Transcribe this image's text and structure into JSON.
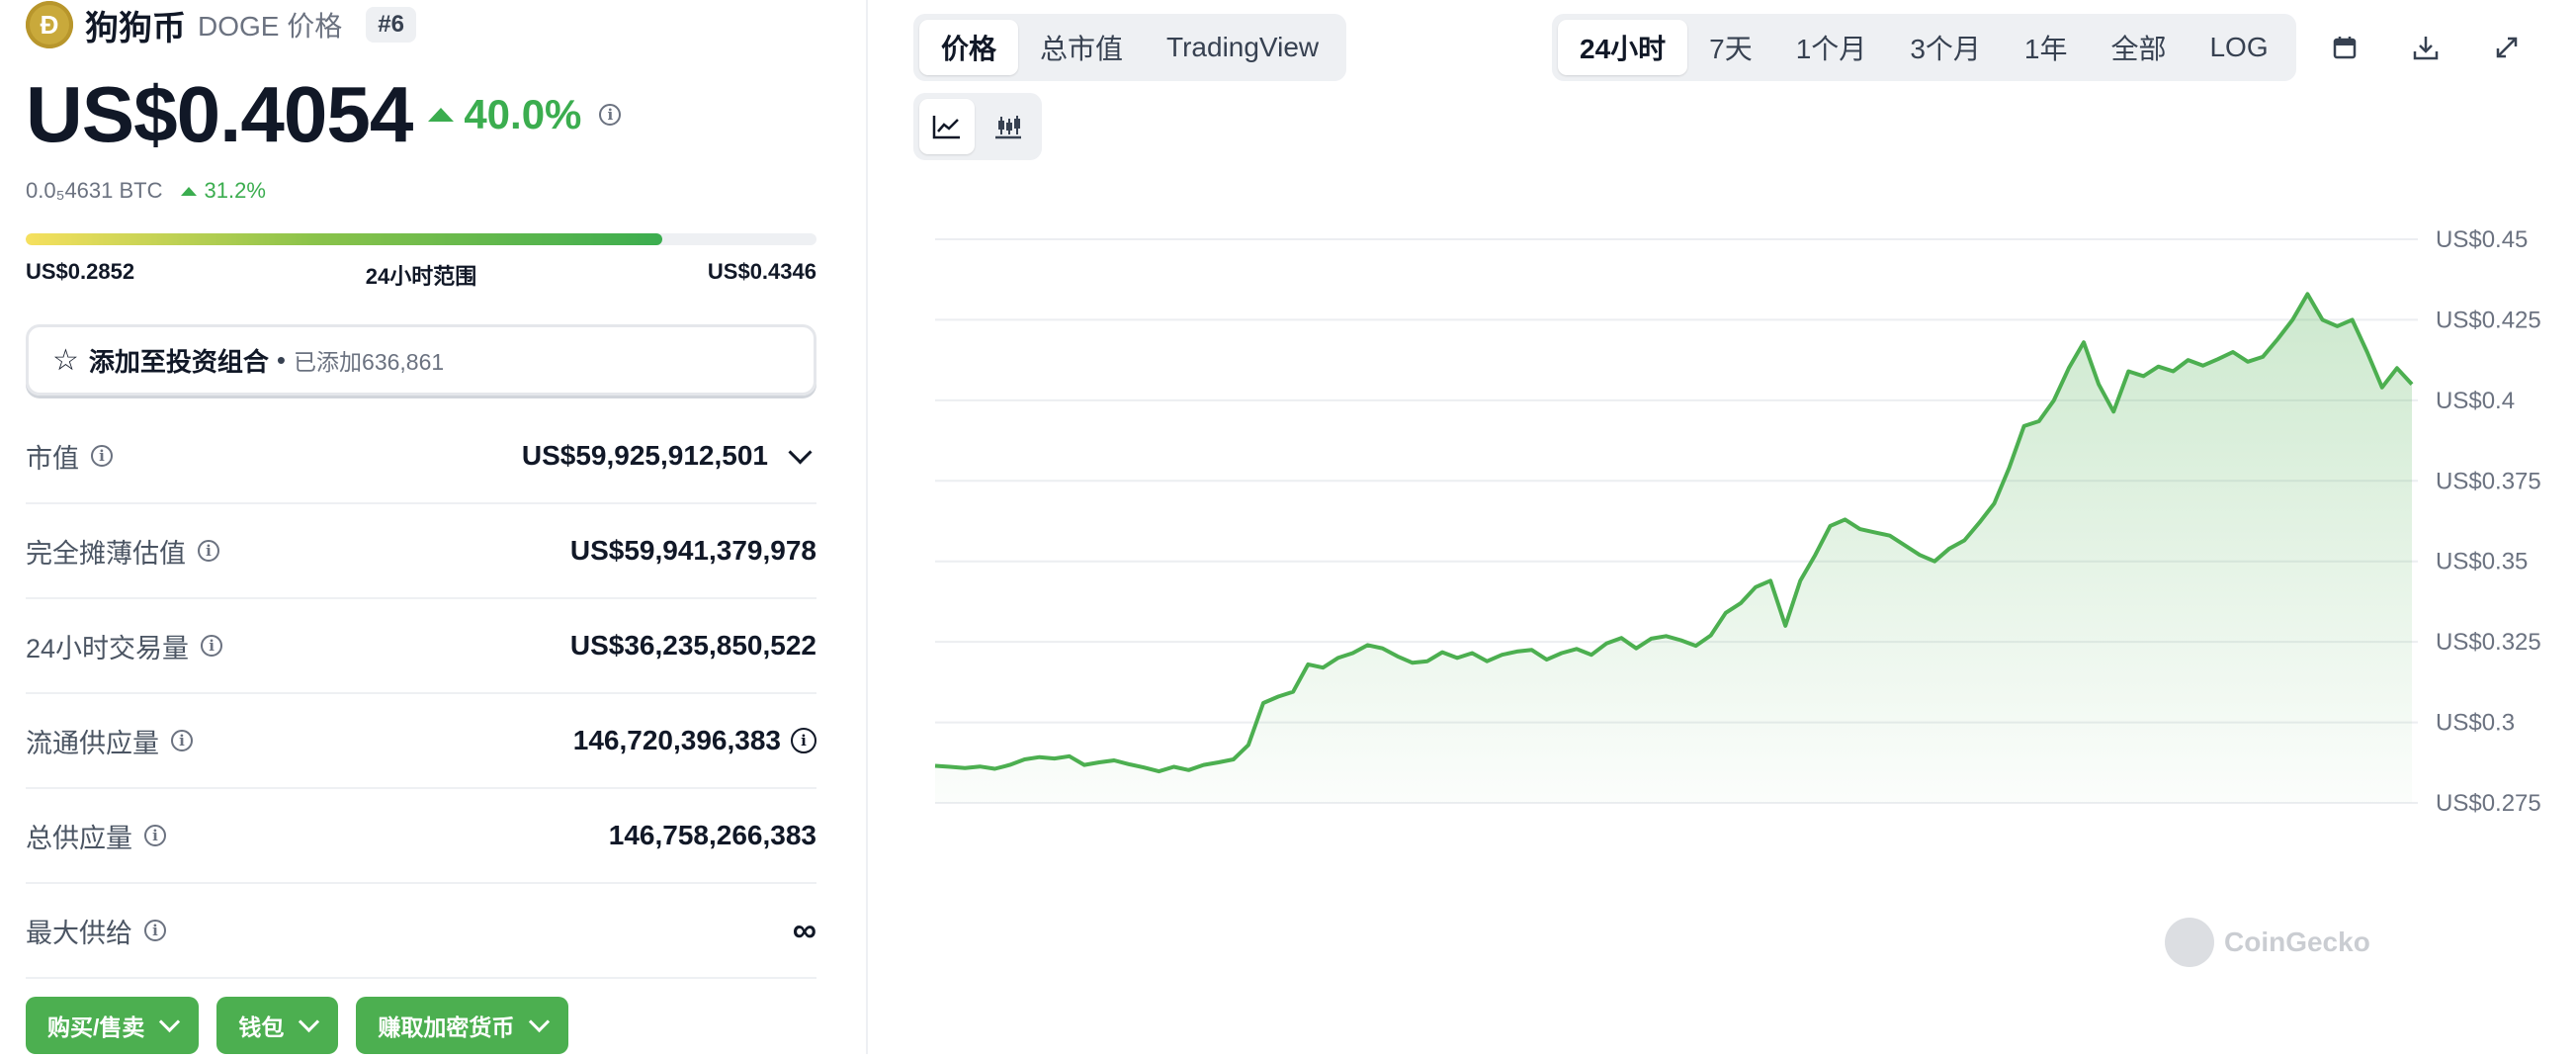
{
  "coin": {
    "logo_letter": "Ð",
    "name": "狗狗币",
    "symbol_label": "DOGE 价格",
    "rank": "#6",
    "price": "US$0.4054",
    "change_pct": "40.0%",
    "btc_price": "0.0₅4631 BTC",
    "btc_change_pct": "31.2%"
  },
  "range": {
    "low": "US$0.2852",
    "label": "24小时范围",
    "high": "US$0.4346",
    "fill_fraction": 0.805
  },
  "portfolio": {
    "label": "添加至投资组合",
    "separator": "•",
    "count": "已添加636,861"
  },
  "stats": [
    {
      "label": "市值",
      "value": "US$59,925,912,501"
    },
    {
      "label": "完全摊薄估值",
      "value": "US$59,941,379,978"
    },
    {
      "label": "24小时交易量",
      "value": "US$36,235,850,522"
    },
    {
      "label": "流通供应量",
      "value": "146,720,396,383"
    },
    {
      "label": "总供应量",
      "value": "146,758,266,383"
    },
    {
      "label": "最大供给",
      "value": "∞"
    }
  ],
  "actions": [
    {
      "label": "购买/售卖"
    },
    {
      "label": "钱包"
    },
    {
      "label": "赚取加密货币"
    }
  ],
  "chart_tabs": [
    {
      "label": "价格",
      "active": true
    },
    {
      "label": "总市值",
      "active": false
    },
    {
      "label": "TradingView",
      "active": false
    }
  ],
  "chart_type_tabs": [
    {
      "icon": "line-chart-icon",
      "active": true
    },
    {
      "icon": "candlestick-icon",
      "active": false
    }
  ],
  "time_tabs": [
    {
      "label": "24小时",
      "active": true
    },
    {
      "label": "7天",
      "active": false
    },
    {
      "label": "1个月",
      "active": false
    },
    {
      "label": "3个月",
      "active": false
    },
    {
      "label": "1年",
      "active": false
    },
    {
      "label": "全部",
      "active": false
    },
    {
      "label": "LOG",
      "active": false
    }
  ],
  "tool_icons": [
    "calendar-icon",
    "download-icon",
    "fullscreen-icon"
  ],
  "watermark": "CoinGecko",
  "colors": {
    "accent_green": "#3bad4f",
    "button_green": "#4caf50",
    "line_green": "#4caf50"
  },
  "chart_data": {
    "type": "area",
    "title": "",
    "xlabel": "",
    "ylabel": "",
    "ylim": [
      0.275,
      0.45
    ],
    "yticks": [
      0.45,
      0.425,
      0.4,
      0.375,
      0.35,
      0.325,
      0.3,
      0.275
    ],
    "ytick_labels": [
      "US$0.45",
      "US$0.425",
      "US$0.4",
      "US$0.375",
      "US$0.35",
      "US$0.325",
      "US$0.3",
      "US$0.275"
    ],
    "grid": true,
    "series": [
      {
        "values": [
          0.2865,
          0.2862,
          0.2858,
          0.2863,
          0.2856,
          0.2868,
          0.2885,
          0.2892,
          0.2888,
          0.2895,
          0.2868,
          0.2876,
          0.2882,
          0.287,
          0.286,
          0.2848,
          0.2862,
          0.2852,
          0.2868,
          0.2876,
          0.2885,
          0.293,
          0.306,
          0.308,
          0.3095,
          0.318,
          0.317,
          0.32,
          0.3215,
          0.324,
          0.323,
          0.3205,
          0.3185,
          0.319,
          0.3218,
          0.32,
          0.3215,
          0.319,
          0.321,
          0.322,
          0.3225,
          0.3195,
          0.3215,
          0.3228,
          0.321,
          0.3245,
          0.3262,
          0.323,
          0.326,
          0.3268,
          0.3255,
          0.3238,
          0.327,
          0.334,
          0.337,
          0.342,
          0.344,
          0.33,
          0.344,
          0.352,
          0.361,
          0.363,
          0.36,
          0.359,
          0.358,
          0.355,
          0.352,
          0.35,
          0.354,
          0.3565,
          0.362,
          0.368,
          0.379,
          0.392,
          0.3935,
          0.4,
          0.41,
          0.418,
          0.405,
          0.3965,
          0.409,
          0.4075,
          0.4105,
          0.409,
          0.4125,
          0.4108,
          0.4128,
          0.415,
          0.412,
          0.4135,
          0.419,
          0.425,
          0.433,
          0.425,
          0.423,
          0.425,
          0.415,
          0.404,
          0.41,
          0.405
        ]
      }
    ]
  }
}
